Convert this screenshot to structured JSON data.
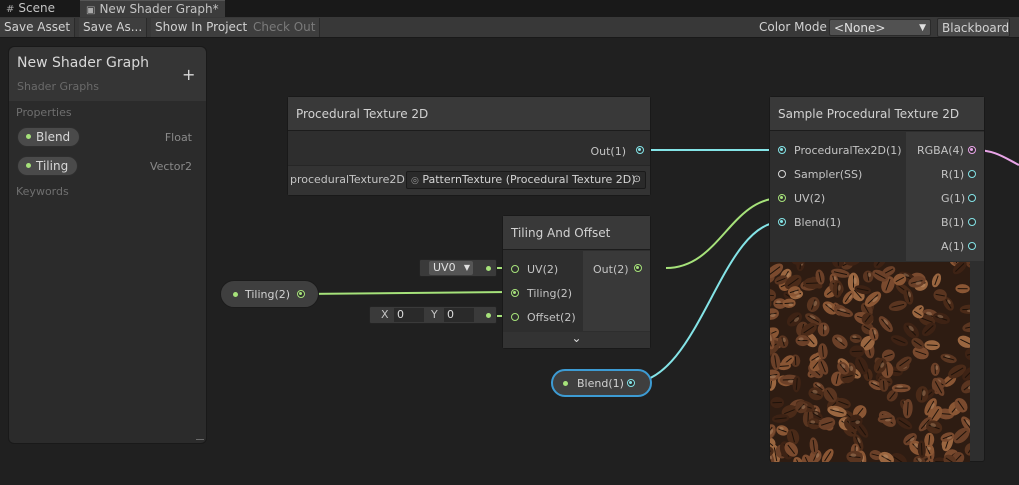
{
  "tabs": [
    {
      "label": "Scene",
      "icon": "grid-icon"
    },
    {
      "label": "New Shader Graph*",
      "icon": "shader-graph-icon"
    }
  ],
  "toolbar": {
    "save_asset": "Save Asset",
    "save_as": "Save As...",
    "show_in_project": "Show In Project",
    "check_out": "Check Out",
    "color_mode_label": "Color Mode",
    "color_mode_value": "<None>",
    "blackboard": "Blackboard"
  },
  "blackboard": {
    "title": "New Shader Graph",
    "subtitle": "Shader Graphs",
    "add": "+",
    "properties_label": "Properties",
    "properties": [
      {
        "name": "Blend",
        "type": "Float"
      },
      {
        "name": "Tiling",
        "type": "Vector2"
      }
    ],
    "keywords_label": "Keywords"
  },
  "nodes": {
    "proc_tex": {
      "title": "Procedural Texture 2D",
      "out": "Out(1)",
      "field_label": "proceduralTexture2D",
      "field_value": "PatternTexture (Procedural Texture 2D)"
    },
    "tiling_offset": {
      "title": "Tiling And Offset",
      "inputs": [
        "UV(2)",
        "Tiling(2)",
        "Offset(2)"
      ],
      "out": "Out(2)",
      "uv_value": "UV0",
      "x_label": "X",
      "x_value": "0",
      "y_label": "Y",
      "y_value": "0",
      "expand": "⌄"
    },
    "sample": {
      "title": "Sample Procedural Texture 2D",
      "inputs": [
        "ProceduralTex2D(1)",
        "Sampler(SS)",
        "UV(2)",
        "Blend(1)"
      ],
      "outputs": [
        "RGBA(4)",
        "R(1)",
        "G(1)",
        "B(1)",
        "A(1)"
      ]
    },
    "tiling_prop": {
      "label": "Tiling(2)"
    },
    "blend_prop": {
      "label": "Blend(1)"
    }
  },
  "colors": {
    "vector1": "#84e4e7",
    "vector2": "#a6e27a",
    "vector4": "#e9a5e8",
    "selection": "#3d9bd3"
  }
}
